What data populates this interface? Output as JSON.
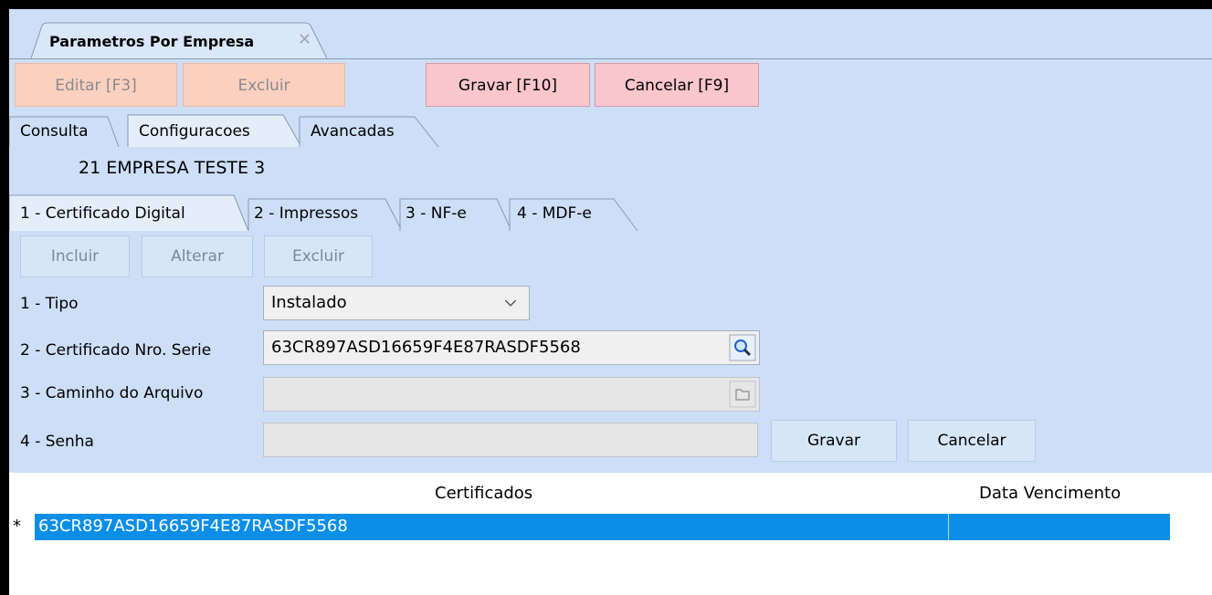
{
  "window": {
    "tab_title": "Parametros Por Empresa",
    "close_glyph": "✕"
  },
  "toolbar": {
    "editar": "Editar [F3]",
    "excluir": "Excluir",
    "gravar": "Gravar [F10]",
    "cancelar": "Cancelar [F9]"
  },
  "main_tabs": [
    "Consulta",
    "Configuracoes",
    "Avancadas"
  ],
  "company": {
    "code": "21",
    "name": "EMPRESA TESTE 3"
  },
  "sub_tabs": [
    "1 - Certificado Digital",
    "2 - Impressos",
    "3 - NF-e",
    "4 - MDF-e"
  ],
  "actions": {
    "incluir": "Incluir",
    "alterar": "Alterar",
    "excluir": "Excluir"
  },
  "form": {
    "tipo_label": "1 - Tipo",
    "tipo_value": "Instalado",
    "serie_label": "2 - Certificado Nro. Serie",
    "serie_value": "63CR897ASD16659F4E87RASDF5568",
    "caminho_label": "3 - Caminho do Arquivo",
    "caminho_value": "",
    "senha_label": "4 - Senha",
    "senha_value": "",
    "gravar": "Gravar",
    "cancelar": "Cancelar"
  },
  "grid": {
    "columns": [
      "Certificados",
      "Data Vencimento"
    ],
    "rows": [
      {
        "marker": "*",
        "certificado": "63CR897ASD16659F4E87RASDF5568",
        "vencimento": ""
      }
    ]
  },
  "colors": {
    "panel": "#cddff7",
    "selected_row": "#0a8ee8",
    "disabled_btn": "#fbd0c0",
    "active_btn": "#f9c6cc"
  }
}
